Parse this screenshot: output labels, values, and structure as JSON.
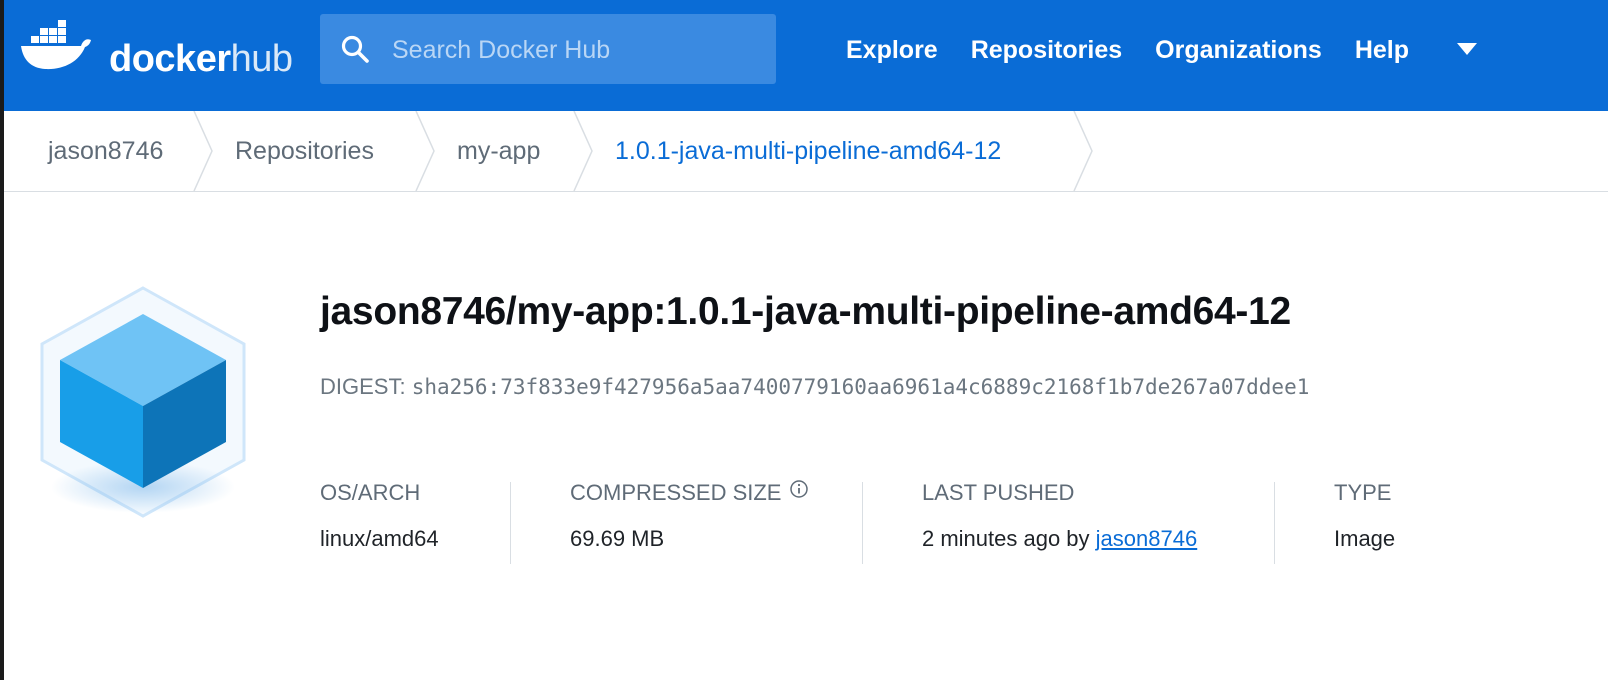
{
  "header": {
    "logo_bold": "docker",
    "logo_light": "hub",
    "search_placeholder": "Search Docker Hub",
    "nav": [
      "Explore",
      "Repositories",
      "Organizations",
      "Help"
    ],
    "brand_color": "#0a6cd6"
  },
  "breadcrumb": [
    "jason8746",
    "Repositories",
    "my-app",
    "1.0.1-java-multi-pipeline-amd64-12"
  ],
  "image": {
    "title": "jason8746/my-app:1.0.1-java-multi-pipeline-amd64-12",
    "digest_label": "DIGEST:",
    "digest_value": "sha256:73f833e9f427956a5aa7400779160aa6961a4c6889c2168f1b7de267a07ddee1"
  },
  "meta": {
    "os_arch_label": "OS/ARCH",
    "os_arch_value": "linux/amd64",
    "size_label": "COMPRESSED SIZE",
    "size_value": "69.69 MB",
    "pushed_label": "LAST PUSHED",
    "pushed_value": "2 minutes ago by",
    "pushed_user": "jason8746",
    "type_label": "TYPE",
    "type_value": "Image"
  }
}
